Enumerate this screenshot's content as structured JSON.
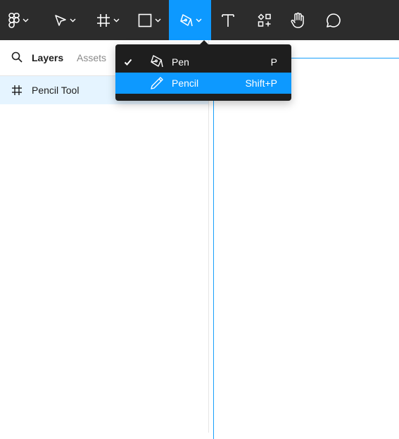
{
  "toolbar": {
    "tools": [
      {
        "icon": "figma-logo-icon",
        "has_menu": true
      },
      {
        "icon": "move-arrow-icon",
        "has_menu": true
      },
      {
        "icon": "frame-hash-icon",
        "has_menu": true
      },
      {
        "icon": "rectangle-icon",
        "has_menu": true
      },
      {
        "icon": "pen-nib-icon",
        "has_menu": true,
        "active": true
      },
      {
        "icon": "text-tool-icon",
        "has_menu": false
      },
      {
        "icon": "resources-icon",
        "has_menu": false
      },
      {
        "icon": "hand-tool-icon",
        "has_menu": false
      },
      {
        "icon": "comment-icon",
        "has_menu": false
      }
    ],
    "colors": {
      "background": "#2c2c2c",
      "active": "#0d99ff"
    }
  },
  "left_panel": {
    "tabs": [
      {
        "label": "Layers",
        "active": true
      },
      {
        "label": "Assets",
        "active": false
      }
    ],
    "layers": [
      {
        "label": "Pencil Tool",
        "icon": "frame-hash-icon",
        "selected": true
      }
    ]
  },
  "pen_menu": {
    "items": [
      {
        "label": "Pen",
        "shortcut": "P",
        "checked": true,
        "highlighted": false,
        "icon": "pen-nib-icon"
      },
      {
        "label": "Pencil",
        "shortcut": "Shift+P",
        "checked": false,
        "highlighted": true,
        "icon": "pencil-icon"
      }
    ]
  },
  "colors": {
    "accent": "#0d99ff",
    "selection": "#e5f4ff",
    "menu_background": "#1e1e1e",
    "canvas_frame": "#18a0fb"
  }
}
